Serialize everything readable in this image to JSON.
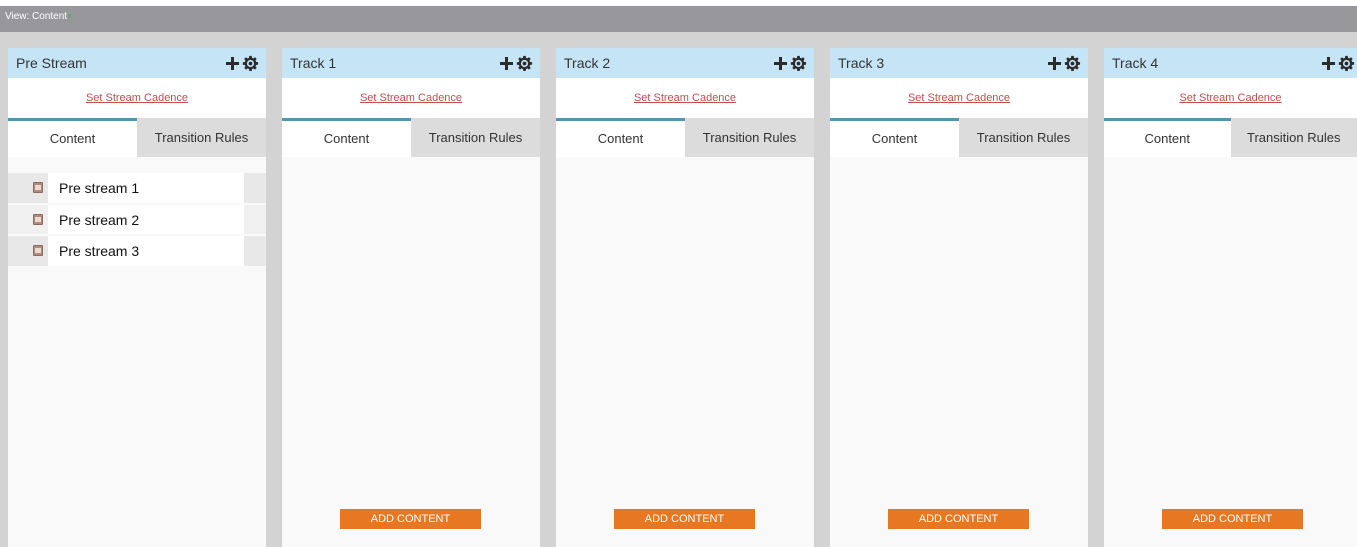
{
  "view": {
    "label": "View: Content",
    "caret": "▾"
  },
  "streams": [
    {
      "title": "Pre Stream",
      "cadence": "Set Stream Cadence",
      "tabs": [
        "Content",
        "Transition Rules"
      ],
      "items": [
        "Pre stream 1",
        "Pre stream 2",
        "Pre stream 3"
      ],
      "add_label": ""
    },
    {
      "title": "Track 1",
      "cadence": "Set Stream Cadence",
      "tabs": [
        "Content",
        "Transition Rules"
      ],
      "items": [],
      "add_label": "ADD CONTENT"
    },
    {
      "title": "Track 2",
      "cadence": "Set Stream Cadence",
      "tabs": [
        "Content",
        "Transition Rules"
      ],
      "items": [],
      "add_label": "ADD CONTENT"
    },
    {
      "title": "Track 3",
      "cadence": "Set Stream Cadence",
      "tabs": [
        "Content",
        "Transition Rules"
      ],
      "items": [],
      "add_label": "ADD CONTENT"
    },
    {
      "title": "Track 4",
      "cadence": "Set Stream Cadence",
      "tabs": [
        "Content",
        "Transition Rules"
      ],
      "items": [],
      "add_label": "ADD CONTENT"
    }
  ],
  "icons": {
    "add": "plus-icon",
    "settings": "gear-icon",
    "item": "email-document-icon"
  },
  "colors": {
    "header": "#c5e5f7",
    "add_button": "#e87722",
    "link": "#c0504d",
    "active_tab": "#5793b3"
  }
}
